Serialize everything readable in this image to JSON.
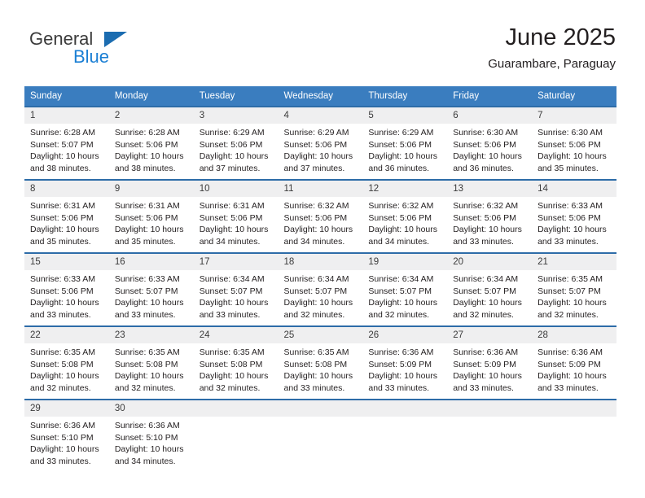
{
  "brand": {
    "name_part1": "General",
    "name_part2": "Blue",
    "triangle_color": "#1b6cb0",
    "blue_color": "#1b7fd4"
  },
  "header": {
    "title": "June 2025",
    "subtitle": "Guarambare, Paraguay"
  },
  "theme": {
    "header_bg": "#3a7dbf",
    "row_divider": "#2d6ca8",
    "daynum_band": "#efeff0"
  },
  "calendar": {
    "weekday_headers": [
      "Sunday",
      "Monday",
      "Tuesday",
      "Wednesday",
      "Thursday",
      "Friday",
      "Saturday"
    ],
    "weeks": [
      [
        {
          "day": "1",
          "sunrise": "Sunrise: 6:28 AM",
          "sunset": "Sunset: 5:07 PM",
          "daylight": "Daylight: 10 hours and 38 minutes."
        },
        {
          "day": "2",
          "sunrise": "Sunrise: 6:28 AM",
          "sunset": "Sunset: 5:06 PM",
          "daylight": "Daylight: 10 hours and 38 minutes."
        },
        {
          "day": "3",
          "sunrise": "Sunrise: 6:29 AM",
          "sunset": "Sunset: 5:06 PM",
          "daylight": "Daylight: 10 hours and 37 minutes."
        },
        {
          "day": "4",
          "sunrise": "Sunrise: 6:29 AM",
          "sunset": "Sunset: 5:06 PM",
          "daylight": "Daylight: 10 hours and 37 minutes."
        },
        {
          "day": "5",
          "sunrise": "Sunrise: 6:29 AM",
          "sunset": "Sunset: 5:06 PM",
          "daylight": "Daylight: 10 hours and 36 minutes."
        },
        {
          "day": "6",
          "sunrise": "Sunrise: 6:30 AM",
          "sunset": "Sunset: 5:06 PM",
          "daylight": "Daylight: 10 hours and 36 minutes."
        },
        {
          "day": "7",
          "sunrise": "Sunrise: 6:30 AM",
          "sunset": "Sunset: 5:06 PM",
          "daylight": "Daylight: 10 hours and 35 minutes."
        }
      ],
      [
        {
          "day": "8",
          "sunrise": "Sunrise: 6:31 AM",
          "sunset": "Sunset: 5:06 PM",
          "daylight": "Daylight: 10 hours and 35 minutes."
        },
        {
          "day": "9",
          "sunrise": "Sunrise: 6:31 AM",
          "sunset": "Sunset: 5:06 PM",
          "daylight": "Daylight: 10 hours and 35 minutes."
        },
        {
          "day": "10",
          "sunrise": "Sunrise: 6:31 AM",
          "sunset": "Sunset: 5:06 PM",
          "daylight": "Daylight: 10 hours and 34 minutes."
        },
        {
          "day": "11",
          "sunrise": "Sunrise: 6:32 AM",
          "sunset": "Sunset: 5:06 PM",
          "daylight": "Daylight: 10 hours and 34 minutes."
        },
        {
          "day": "12",
          "sunrise": "Sunrise: 6:32 AM",
          "sunset": "Sunset: 5:06 PM",
          "daylight": "Daylight: 10 hours and 34 minutes."
        },
        {
          "day": "13",
          "sunrise": "Sunrise: 6:32 AM",
          "sunset": "Sunset: 5:06 PM",
          "daylight": "Daylight: 10 hours and 33 minutes."
        },
        {
          "day": "14",
          "sunrise": "Sunrise: 6:33 AM",
          "sunset": "Sunset: 5:06 PM",
          "daylight": "Daylight: 10 hours and 33 minutes."
        }
      ],
      [
        {
          "day": "15",
          "sunrise": "Sunrise: 6:33 AM",
          "sunset": "Sunset: 5:06 PM",
          "daylight": "Daylight: 10 hours and 33 minutes."
        },
        {
          "day": "16",
          "sunrise": "Sunrise: 6:33 AM",
          "sunset": "Sunset: 5:07 PM",
          "daylight": "Daylight: 10 hours and 33 minutes."
        },
        {
          "day": "17",
          "sunrise": "Sunrise: 6:34 AM",
          "sunset": "Sunset: 5:07 PM",
          "daylight": "Daylight: 10 hours and 33 minutes."
        },
        {
          "day": "18",
          "sunrise": "Sunrise: 6:34 AM",
          "sunset": "Sunset: 5:07 PM",
          "daylight": "Daylight: 10 hours and 32 minutes."
        },
        {
          "day": "19",
          "sunrise": "Sunrise: 6:34 AM",
          "sunset": "Sunset: 5:07 PM",
          "daylight": "Daylight: 10 hours and 32 minutes."
        },
        {
          "day": "20",
          "sunrise": "Sunrise: 6:34 AM",
          "sunset": "Sunset: 5:07 PM",
          "daylight": "Daylight: 10 hours and 32 minutes."
        },
        {
          "day": "21",
          "sunrise": "Sunrise: 6:35 AM",
          "sunset": "Sunset: 5:07 PM",
          "daylight": "Daylight: 10 hours and 32 minutes."
        }
      ],
      [
        {
          "day": "22",
          "sunrise": "Sunrise: 6:35 AM",
          "sunset": "Sunset: 5:08 PM",
          "daylight": "Daylight: 10 hours and 32 minutes."
        },
        {
          "day": "23",
          "sunrise": "Sunrise: 6:35 AM",
          "sunset": "Sunset: 5:08 PM",
          "daylight": "Daylight: 10 hours and 32 minutes."
        },
        {
          "day": "24",
          "sunrise": "Sunrise: 6:35 AM",
          "sunset": "Sunset: 5:08 PM",
          "daylight": "Daylight: 10 hours and 32 minutes."
        },
        {
          "day": "25",
          "sunrise": "Sunrise: 6:35 AM",
          "sunset": "Sunset: 5:08 PM",
          "daylight": "Daylight: 10 hours and 33 minutes."
        },
        {
          "day": "26",
          "sunrise": "Sunrise: 6:36 AM",
          "sunset": "Sunset: 5:09 PM",
          "daylight": "Daylight: 10 hours and 33 minutes."
        },
        {
          "day": "27",
          "sunrise": "Sunrise: 6:36 AM",
          "sunset": "Sunset: 5:09 PM",
          "daylight": "Daylight: 10 hours and 33 minutes."
        },
        {
          "day": "28",
          "sunrise": "Sunrise: 6:36 AM",
          "sunset": "Sunset: 5:09 PM",
          "daylight": "Daylight: 10 hours and 33 minutes."
        }
      ],
      [
        {
          "day": "29",
          "sunrise": "Sunrise: 6:36 AM",
          "sunset": "Sunset: 5:10 PM",
          "daylight": "Daylight: 10 hours and 33 minutes."
        },
        {
          "day": "30",
          "sunrise": "Sunrise: 6:36 AM",
          "sunset": "Sunset: 5:10 PM",
          "daylight": "Daylight: 10 hours and 34 minutes."
        },
        {
          "day": "",
          "sunrise": "",
          "sunset": "",
          "daylight": ""
        },
        {
          "day": "",
          "sunrise": "",
          "sunset": "",
          "daylight": ""
        },
        {
          "day": "",
          "sunrise": "",
          "sunset": "",
          "daylight": ""
        },
        {
          "day": "",
          "sunrise": "",
          "sunset": "",
          "daylight": ""
        },
        {
          "day": "",
          "sunrise": "",
          "sunset": "",
          "daylight": ""
        }
      ]
    ]
  }
}
